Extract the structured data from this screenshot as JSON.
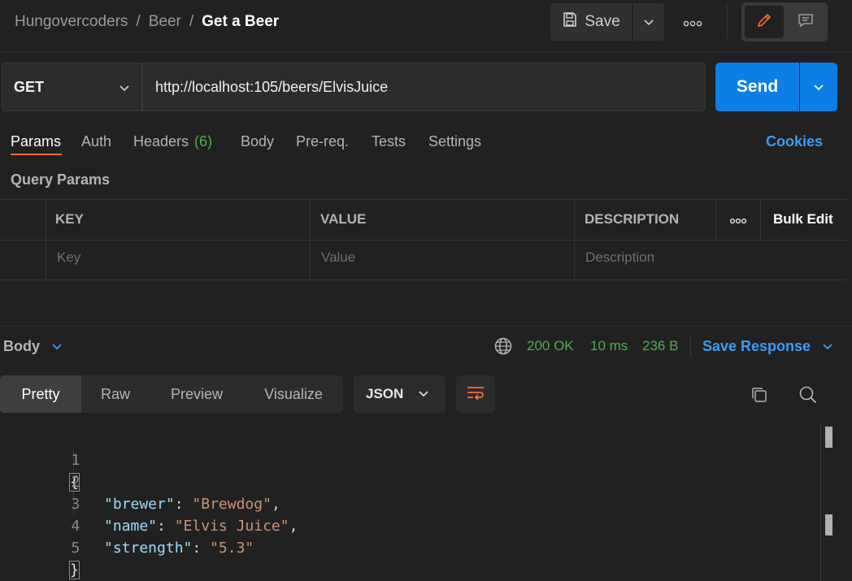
{
  "breadcrumb": {
    "workspace": "Hungovercoders",
    "collection": "Beer",
    "request": "Get a Beer",
    "separator": "/"
  },
  "toolbar": {
    "save_label": "Save"
  },
  "request": {
    "method": "GET",
    "url": "http://localhost:105/beers/ElvisJuice",
    "send_label": "Send"
  },
  "request_tabs": {
    "params": "Params",
    "auth": "Auth",
    "headers": "Headers",
    "headers_count": "(6)",
    "body": "Body",
    "prereq": "Pre-req.",
    "tests": "Tests",
    "settings": "Settings",
    "cookies": "Cookies"
  },
  "params": {
    "section_title": "Query Params",
    "columns": {
      "key": "KEY",
      "value": "VALUE",
      "description": "DESCRIPTION",
      "bulk_edit": "Bulk Edit"
    },
    "placeholders": {
      "key": "Key",
      "value": "Value",
      "description": "Description"
    }
  },
  "response": {
    "body_label": "Body",
    "status": "200 OK",
    "time": "10 ms",
    "size": "236 B",
    "save_response": "Save Response",
    "view_tabs": [
      "Pretty",
      "Raw",
      "Preview",
      "Visualize"
    ],
    "format": "JSON"
  },
  "code": {
    "line_numbers": [
      "1",
      "2",
      "3",
      "4",
      "5"
    ],
    "open_brace": "{",
    "close_brace": "}",
    "fields": [
      {
        "key": "\"brewer\"",
        "value": "\"Brewdog\"",
        "trail": ","
      },
      {
        "key": "\"name\"",
        "value": "\"Elvis Juice\"",
        "trail": ","
      },
      {
        "key": "\"strength\"",
        "value": "\"5.3\"",
        "trail": ""
      }
    ],
    "colon": ": "
  },
  "colors": {
    "accent": "#0b7fe6",
    "tab_active": "#ff6c37",
    "success": "#4caf50",
    "link": "#3b9cf3"
  },
  "icons": [
    "save-icon",
    "chevron-down-icon",
    "more-icon",
    "pencil-icon",
    "comment-icon",
    "globe-icon",
    "wrap-icon",
    "copy-icon",
    "search-icon"
  ]
}
